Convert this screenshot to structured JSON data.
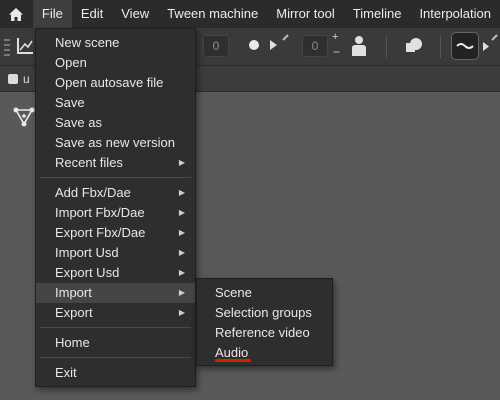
{
  "menubar": {
    "items": [
      {
        "label": "File"
      },
      {
        "label": "Edit"
      },
      {
        "label": "View"
      },
      {
        "label": "Tween machine"
      },
      {
        "label": "Mirror tool"
      },
      {
        "label": "Timeline"
      },
      {
        "label": "Interpolation"
      }
    ]
  },
  "toolbar": {
    "field1": "0",
    "field2": "0"
  },
  "tab": {
    "label": "u"
  },
  "file_menu": {
    "items": [
      {
        "label": "New scene"
      },
      {
        "label": "Open"
      },
      {
        "label": "Open autosave file"
      },
      {
        "label": "Save"
      },
      {
        "label": "Save as"
      },
      {
        "label": "Save as new version"
      },
      {
        "label": "Recent files"
      },
      {
        "label": "Add Fbx/Dae"
      },
      {
        "label": "Import Fbx/Dae"
      },
      {
        "label": "Export Fbx/Dae"
      },
      {
        "label": "Import Usd"
      },
      {
        "label": "Export Usd"
      },
      {
        "label": "Import"
      },
      {
        "label": "Export"
      },
      {
        "label": "Home"
      },
      {
        "label": "Exit"
      }
    ]
  },
  "import_submenu": {
    "items": [
      {
        "label": "Scene"
      },
      {
        "label": "Selection groups"
      },
      {
        "label": "Reference video"
      },
      {
        "label": "Audio"
      }
    ]
  },
  "colors": {
    "menubar_bg": "#2b2b2b",
    "menu_bg": "#2e2e2e",
    "highlight": "#454545",
    "underline": "#e01515",
    "viewport": "#595959"
  }
}
